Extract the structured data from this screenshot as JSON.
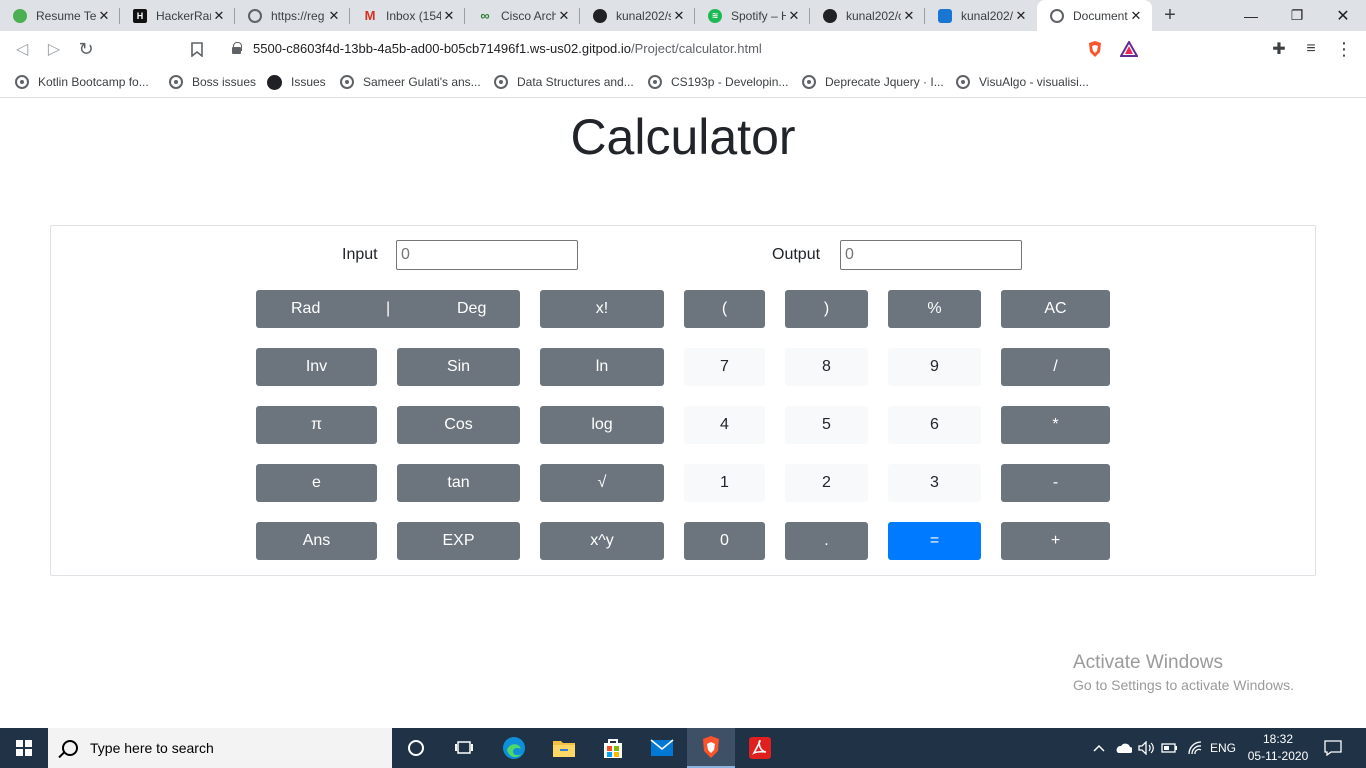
{
  "browser": {
    "tabs": [
      {
        "title": "Resume Te",
        "color": "#4caf50",
        "glyph": "6"
      },
      {
        "title": "HackerRan",
        "color": "#1ba94c",
        "glyph": "H"
      },
      {
        "title": "https://reg",
        "color": "#5f6368",
        "glyph": ""
      },
      {
        "title": "Inbox (154",
        "color": "#d93025",
        "glyph": "M"
      },
      {
        "title": "Cisco Archi",
        "color": "#2e7d32",
        "glyph": "∞"
      },
      {
        "title": "kunal202/s",
        "color": "#202124",
        "glyph": ""
      },
      {
        "title": "Spotify – H",
        "color": "#1db954",
        "glyph": "≋"
      },
      {
        "title": "kunal202/c",
        "color": "#202124",
        "glyph": ""
      },
      {
        "title": "kunal202/c",
        "color": "#1976d2",
        "glyph": "⬡"
      },
      {
        "title": "Document",
        "color": "#5f6368",
        "glyph": ""
      }
    ],
    "url_host": "5500-c8603f4d-13bb-4a5b-ad00-b05cb71496f1.ws-us02.gitpod.io",
    "url_path": "/Project/calculator.html",
    "bookmarks": [
      {
        "label": "Kotlin Bootcamp fo...",
        "icon": "globe"
      },
      {
        "label": "Boss issues",
        "icon": "globe"
      },
      {
        "label": "Issues",
        "icon": "github"
      },
      {
        "label": "Sameer Gulati's ans...",
        "icon": "globe"
      },
      {
        "label": "Data Structures and...",
        "icon": "globe"
      },
      {
        "label": "CS193p - Developin...",
        "icon": "globe"
      },
      {
        "label": "Deprecate Jquery · I...",
        "icon": "globe"
      },
      {
        "label": "VisuAlgo - visualisi...",
        "icon": "globe"
      }
    ]
  },
  "page": {
    "title": "Calculator",
    "input_label": "Input",
    "input_placeholder": "0",
    "output_label": "Output",
    "output_placeholder": "0"
  },
  "keys": {
    "rad": "Rad",
    "divider": "|",
    "deg": "Deg",
    "fact": "x!",
    "lparen": "(",
    "rparen": ")",
    "percent": "%",
    "ac": "AC",
    "inv": "Inv",
    "sin": "Sin",
    "ln": "ln",
    "n7": "7",
    "n8": "8",
    "n9": "9",
    "div": "/",
    "pi": "π",
    "cos": "Cos",
    "log": "log",
    "n4": "4",
    "n5": "5",
    "n6": "6",
    "mul": "*",
    "e": "e",
    "tan": "tan",
    "sqrt": "√",
    "n1": "1",
    "n2": "2",
    "n3": "3",
    "sub": "-",
    "ans": "Ans",
    "exp": "EXP",
    "pow": "x^y",
    "n0": "0",
    "dot": ".",
    "eq": "=",
    "add": "+"
  },
  "watermark": {
    "line1": "Activate Windows",
    "line2": "Go to Settings to activate Windows."
  },
  "taskbar": {
    "search_placeholder": "Type here to search",
    "lang": "ENG",
    "time": "18:32",
    "date": "05-11-2020"
  }
}
